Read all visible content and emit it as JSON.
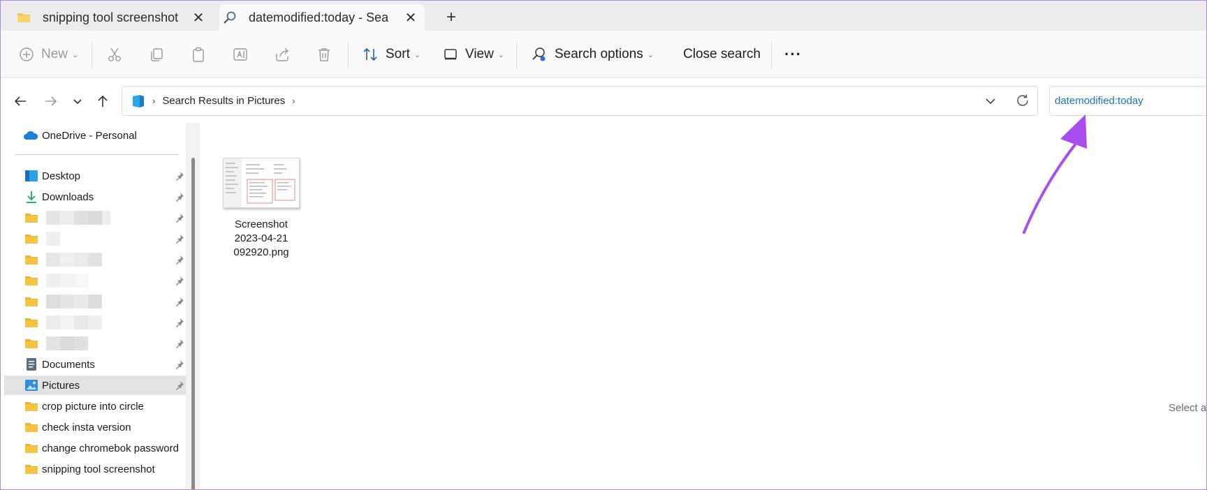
{
  "tabs": [
    {
      "label": "snipping tool screenshot",
      "icon": "folder-icon",
      "active": false
    },
    {
      "label": "datemodified:today - Sea",
      "icon": "search-icon",
      "active": true
    }
  ],
  "toolbar": {
    "new_label": "New",
    "sort_label": "Sort",
    "view_label": "View",
    "search_options_label": "Search options",
    "close_search_label": "Close search",
    "more_label": "···"
  },
  "address": {
    "location": "Search Results in Pictures"
  },
  "search": {
    "query": "datemodified:today"
  },
  "sidebar": {
    "onedrive": "OneDrive - Personal",
    "items": [
      {
        "label": "Desktop",
        "icon": "desktop-icon",
        "pinned": true
      },
      {
        "label": "Downloads",
        "icon": "download-icon",
        "pinned": true
      },
      {
        "label": "Documents",
        "icon": "documents-icon",
        "pinned": true
      },
      {
        "label": "Pictures",
        "icon": "pictures-icon",
        "pinned": true,
        "selected": true
      },
      {
        "label": "crop picture into circle",
        "icon": "folder-icon"
      },
      {
        "label": "check insta version",
        "icon": "folder-icon"
      },
      {
        "label": "change chromebok password",
        "icon": "folder-icon"
      },
      {
        "label": "snipping tool screenshot",
        "icon": "folder-icon"
      }
    ]
  },
  "content": {
    "file": {
      "name_line1": "Screenshot",
      "name_line2": "2023-04-21",
      "name_line3": "092920.png"
    },
    "status_text": "Select a"
  },
  "colors": {
    "accent": "#1a73c9",
    "folder": "#f5c445",
    "annotation_arrow": "#a94df0",
    "selected_bg": "#e3e3e3"
  }
}
